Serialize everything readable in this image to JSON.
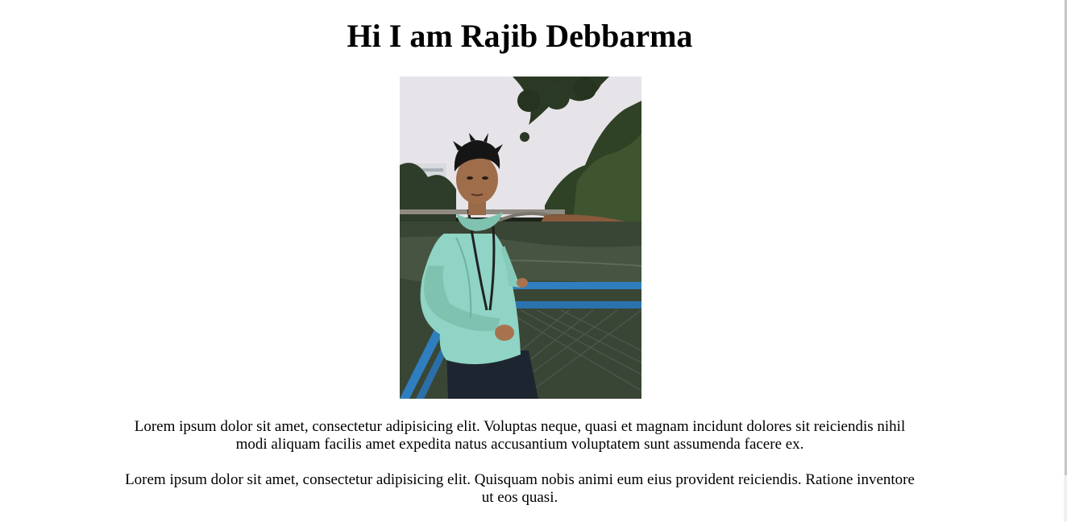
{
  "page": {
    "heading": "Hi I am Rajib Debbarma",
    "profile_photo": {
      "subject": "man in mint hoodie standing by blue railing at a lake with bridge and trees"
    },
    "paragraphs": [
      "Lorem ipsum dolor sit amet, consectetur adipisicing elit. Voluptas neque, quasi et magnam incidunt dolores sit reiciendis nihil modi aliquam facilis amet expedita natus accusantium voluptatem sunt assumenda facere ex.",
      "Lorem ipsum dolor sit amet, consectetur adipisicing elit. Quisquam nobis animi eum eius provident reiciendis. Ratione inventore ut eos quasi."
    ]
  },
  "colors": {
    "background": "#ffffff",
    "text": "#000000",
    "hoodie": "#8fd4c4",
    "railing": "#2f7fc0",
    "water": "#3a4a36",
    "sky": "#e8e6ea"
  }
}
